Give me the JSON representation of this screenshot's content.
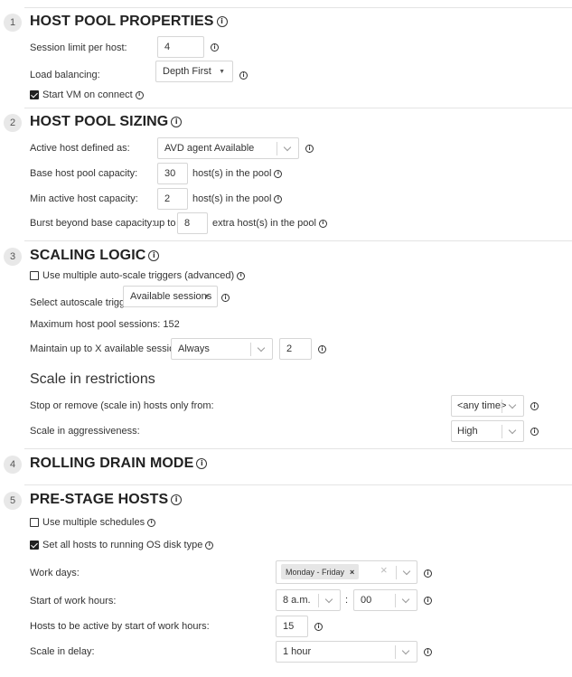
{
  "sections": {
    "s1": {
      "num": "1",
      "title": "HOST POOL PROPERTIES"
    },
    "s2": {
      "num": "2",
      "title": "HOST POOL SIZING"
    },
    "s3": {
      "num": "3",
      "title": "SCALING LOGIC"
    },
    "s4": {
      "num": "4",
      "title": "ROLLING DRAIN MODE"
    },
    "s5": {
      "num": "5",
      "title": "PRE-STAGE HOSTS"
    }
  },
  "props": {
    "session_limit_label": "Session limit per host:",
    "session_limit_value": "4",
    "load_balancing_label": "Load balancing:",
    "load_balancing_value": "Depth First",
    "start_vm_label": "Start VM on connect"
  },
  "sizing": {
    "active_host_label": "Active host defined as:",
    "active_host_value": "AVD agent Available",
    "base_capacity_label": "Base host pool capacity:",
    "base_capacity_value": "30",
    "base_capacity_suffix": "host(s) in the pool",
    "min_active_label": "Min active host capacity:",
    "min_active_value": "2",
    "min_active_suffix": "host(s) in the pool",
    "burst_label": "Burst beyond base capacity:",
    "burst_prefix": "up to",
    "burst_value": "8",
    "burst_suffix": "extra host(s) in the pool"
  },
  "scaling": {
    "multi_triggers_label": "Use multiple auto-scale triggers (advanced)",
    "select_trigger_label": "Select autoscale trigger",
    "select_trigger_value": "Available sessions",
    "max_sessions_text": "Maximum host pool sessions: 152",
    "maintain_label": "Maintain up to X available sessions:",
    "maintain_mode_value": "Always",
    "maintain_count_value": "2",
    "scale_in_title": "Scale in restrictions",
    "stop_remove_label": "Stop or remove (scale in) hosts only from:",
    "stop_remove_value": "<any time>",
    "aggressiveness_label": "Scale in aggressiveness:",
    "aggressiveness_value": "High"
  },
  "prestage": {
    "multi_schedules_label": "Use multiple schedules",
    "set_running_label": "Set all hosts to running OS disk type",
    "work_days_label": "Work days:",
    "work_days_tag": "Monday - Friday",
    "start_hours_label": "Start of work hours:",
    "start_hour_value": "8 a.m.",
    "time_sep": ":",
    "start_minute_value": "00",
    "hosts_active_label": "Hosts to be active by start of work hours:",
    "hosts_active_value": "15",
    "scale_delay_label": "Scale in delay:",
    "scale_delay_value": "1 hour"
  },
  "icons": {
    "info": "i",
    "tag_remove": "×",
    "clear": "×",
    "caret": "▼"
  }
}
